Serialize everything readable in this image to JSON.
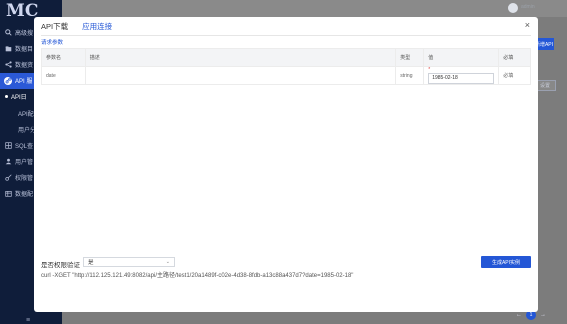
{
  "logo": "MC",
  "sidebar": {
    "items": [
      {
        "label": "高级搜",
        "icon": "search-icon"
      },
      {
        "label": "数据目",
        "icon": "folder-icon"
      },
      {
        "label": "数据资",
        "icon": "share-icon"
      },
      {
        "label": "API 服",
        "icon": "link-icon",
        "active": true
      },
      {
        "label": "API日",
        "sub": true,
        "selected": true
      },
      {
        "label": "API配置",
        "sub": true
      },
      {
        "label": "用户分",
        "sub": true
      },
      {
        "label": "SQL查",
        "icon": "table-icon"
      },
      {
        "label": "用户管",
        "icon": "user-icon"
      },
      {
        "label": "权限管",
        "icon": "key-icon"
      },
      {
        "label": "数据配",
        "icon": "database-icon"
      }
    ],
    "collapse_label": "≡"
  },
  "header": {
    "username": "admin"
  },
  "background": {
    "primary_button": "新增API",
    "secondary_button": "设置",
    "pager_prev": "←",
    "pager_current": "1",
    "pager_next": "→"
  },
  "modal": {
    "tabs": [
      {
        "label": "API下载"
      },
      {
        "label": "应用连接",
        "active": true
      }
    ],
    "close": "×",
    "section_title": "请求参数",
    "table": {
      "headers": [
        "参数名",
        "描述",
        "类型",
        "值",
        "必填"
      ],
      "rows": [
        {
          "name": "date",
          "description": "",
          "type": "string",
          "value": "1985-02-18",
          "required": "必填"
        }
      ]
    },
    "permission_label": "是否权限验证",
    "permission_value": "是",
    "generate_button": "生成API实例",
    "curl": "curl -XGET \"http://112.125.121.49:8082/api/主路径/test1/20a1489f-c02e-4d38-8fdb-a13c88a437d7?date=1985-02-18\""
  }
}
